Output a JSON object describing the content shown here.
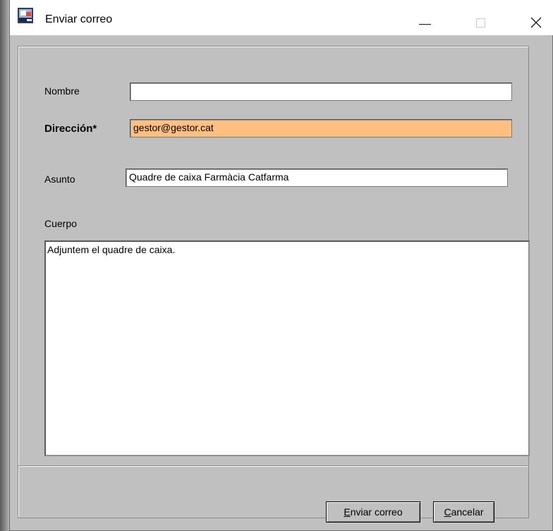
{
  "window": {
    "title": "Enviar correo"
  },
  "form": {
    "nombre": {
      "label": "Nombre",
      "value": ""
    },
    "direccion": {
      "label": "Dirección*",
      "value": "gestor@gestor.cat",
      "highlight_color": "#ffbf80"
    },
    "asunto": {
      "label": "Asunto",
      "value": "Quadre de caixa Farmàcia Catfarma"
    },
    "cuerpo": {
      "label": "Cuerpo",
      "value": "Adjuntem el quadre de caixa."
    }
  },
  "buttons": {
    "send": {
      "mnemonic": "E",
      "rest": "nviar correo"
    },
    "cancel": {
      "mnemonic": "C",
      "rest": "ancelar"
    }
  },
  "icons": {
    "app": "app-icon",
    "minimize": "minimize-icon",
    "maximize": "maximize-icon",
    "close": "close-icon"
  }
}
